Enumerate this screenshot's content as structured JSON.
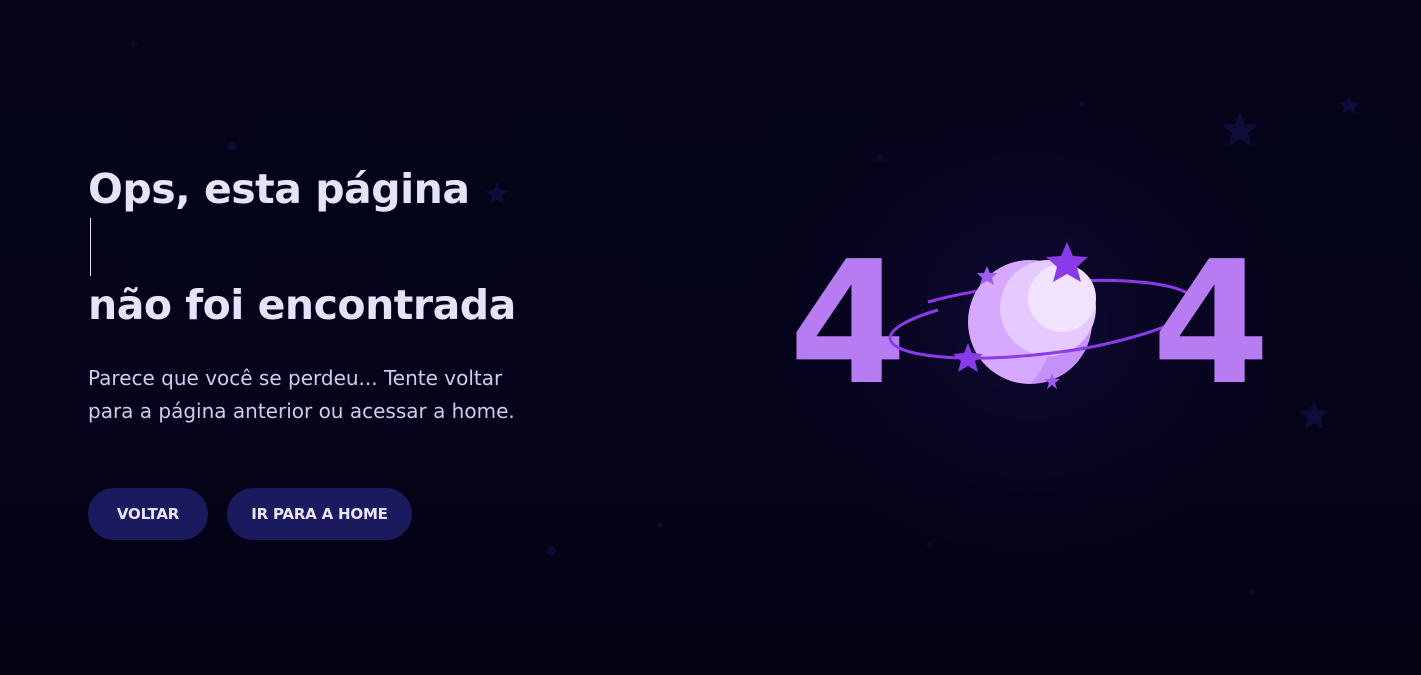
{
  "heading": {
    "line1": "Ops, esta página",
    "line2": "não foi encontrada"
  },
  "description": {
    "line1": "Parece que você se perdeu... Tente voltar",
    "line2": "para a página anterior ou acessar a home."
  },
  "buttons": {
    "back_label": "VOLTAR",
    "home_label": "IR PARA A HOME"
  },
  "illustration": {
    "digit_left": "4",
    "digit_right": "4",
    "planet_icon": "planet-with-ring-and-stars"
  },
  "colors": {
    "background": "#05041a",
    "accent_purple": "#b77cf2",
    "planet_light": "#e6c9ff",
    "star_purple": "#8a3ae8",
    "button_bg": "#1b1a5e",
    "heading_text": "#e5e3fb"
  }
}
